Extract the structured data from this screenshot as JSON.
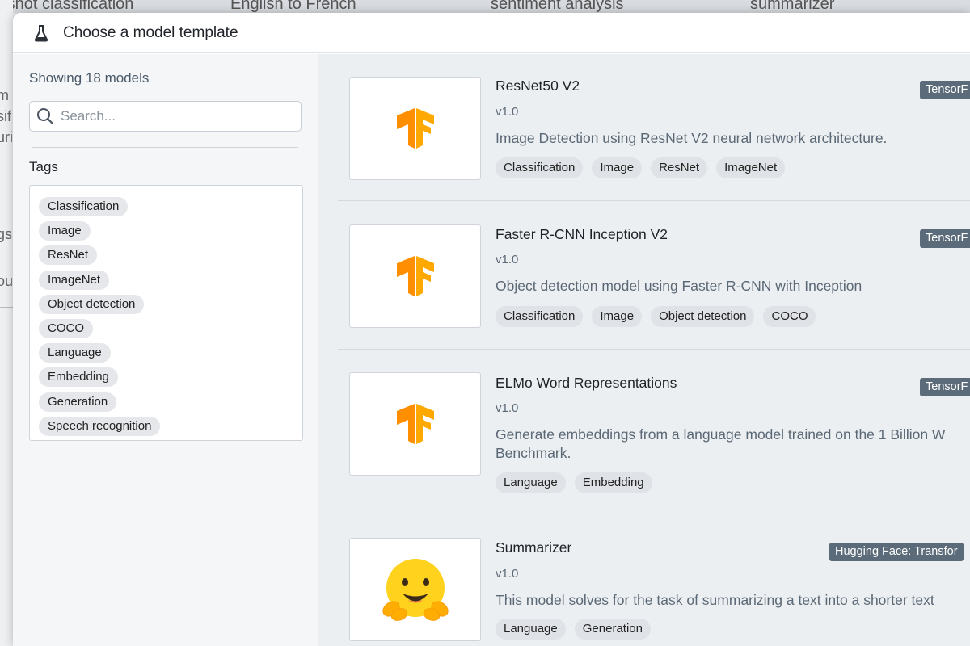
{
  "background": {
    "tabs": [
      "y-shot classification",
      "English to French",
      "sentiment analysis",
      "summarizer"
    ],
    "left_fragments": [
      "m",
      "sif",
      "uri",
      "gs",
      "ou"
    ]
  },
  "modal": {
    "title": "Choose a model template",
    "icon": "flask-icon"
  },
  "sidebar": {
    "showing": "Showing 18 models",
    "search_placeholder": "Search...",
    "tags_heading": "Tags",
    "tags": [
      "Classification",
      "Image",
      "ResNet",
      "ImageNet",
      "Object detection",
      "COCO",
      "Language",
      "Embedding",
      "Generation",
      "Speech recognition"
    ]
  },
  "models": [
    {
      "title": "ResNet50 V2",
      "version": "v1.0",
      "description": [
        "Image Detection using ResNet V2 neural network architecture."
      ],
      "tags": [
        "Classification",
        "Image",
        "ResNet",
        "ImageNet"
      ],
      "badge": "TensorF",
      "logo": "tensorflow-logo"
    },
    {
      "title": "Faster R-CNN Inception V2",
      "version": "v1.0",
      "description": [
        "Object detection model using Faster R-CNN with Inception"
      ],
      "tags": [
        "Classification",
        "Image",
        "Object detection",
        "COCO"
      ],
      "badge": "TensorF",
      "logo": "tensorflow-logo"
    },
    {
      "title": "ELMo Word Representations",
      "version": "v1.0",
      "description": [
        "Generate embeddings from a language model trained on the 1 Billion W",
        "Benchmark."
      ],
      "tags": [
        "Language",
        "Embedding"
      ],
      "badge": "TensorF",
      "logo": "tensorflow-logo"
    },
    {
      "title": "Summarizer",
      "version": "v1.0",
      "description": [
        "This model solves for the task of summarizing a text into a shorter text"
      ],
      "tags": [
        "Language",
        "Generation"
      ],
      "badge": "Hugging Face: Transfor",
      "logo": "hugging-face-logo"
    }
  ],
  "colors": {
    "tensorflow_orange": "#ff8f00",
    "badge_bg": "#5b6b79",
    "hugging_yellow": "#ffd21e"
  }
}
